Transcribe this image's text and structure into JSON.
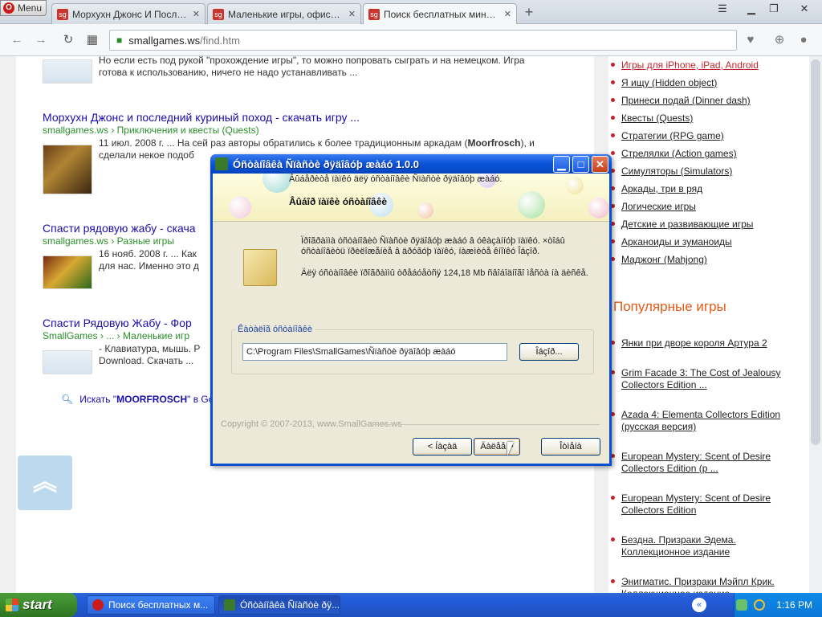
{
  "browser": {
    "menu_label": "Menu",
    "tabs": [
      {
        "label": "Морхухн Джонс И Последний...",
        "active": false
      },
      {
        "label": "Маленькие игры, офисные...",
        "active": false
      },
      {
        "label": "Поиск бесплатных мини игр...",
        "active": true
      }
    ],
    "address": {
      "host": "smallgames.ws",
      "path": "/find.htm"
    }
  },
  "results": [
    {
      "title": "",
      "url": "",
      "desc": "Но если есть под рукой \"прохождение игры\", то можно попровать сыграть и на немецком. Игра готова к использованию, ничего не надо устанавливать ..."
    },
    {
      "title": "Морхухн Джонс и последний куриный поход - скачать игру ...",
      "url": "smallgames.ws › Приключения и квесты (Quests)",
      "desc_date": "11 июл. 2008 г.",
      "desc_pre": " ... На сей раз авторы обратились к более традиционным аркадам (",
      "desc_bold": "Moorfrosch",
      "desc_post": "), и сделали некое подоб"
    },
    {
      "title": "Спасти рядовую жабу - скача",
      "url": "smallgames.ws › Разные игры",
      "desc_date": "16 нояб. 2008 г.",
      "desc_pre": " ... Как",
      "desc_line2": "для нас. Именно это д"
    },
    {
      "title": "Спасти Рядовую Жабу - Фор",
      "url": "SmallGames › ... › Маленькие игр",
      "desc_line1": "- Клавиатура, мышь. Р",
      "desc_line2": "Download. Скачать ..."
    }
  ],
  "search_more": {
    "prefix": "Искать \"",
    "query": "MOORFROSCH",
    "suffix": "\" в Go"
  },
  "sidebar": {
    "categories": [
      {
        "label": "Игры для iPhone, iPad, Android",
        "active": true
      },
      {
        "label": "Я ищу (Hidden object)",
        "active": false
      },
      {
        "label": "Принеси подай (Dinner dash)",
        "active": false
      },
      {
        "label": "Квесты (Quests)",
        "active": false
      },
      {
        "label": "Стратегии (RPG game)",
        "active": false
      },
      {
        "label": "Стрелялки (Action games)",
        "active": false
      },
      {
        "label": "Симуляторы (Simulators)",
        "active": false
      },
      {
        "label": "Аркады, три в ряд",
        "active": false
      },
      {
        "label": "Логические игры",
        "active": false
      },
      {
        "label": "Детские и развивающие игры",
        "active": false
      },
      {
        "label": "Арканоиды и зуманоиды",
        "active": false
      },
      {
        "label": "Маджонг (Mahjong)",
        "active": false
      }
    ],
    "popular_title": "Популярные игры",
    "popular": [
      "Янки при дворе короля Артура 2",
      "Grim Facade 3: The Cost of Jealousy Collectors Edition ...",
      "Azada 4: Elementa Collectors Edition (русская версия)",
      "European Mystery: Scent of Desire Collectors Edition (р ...",
      "European Mystery: Scent of Desire Collectors Edition",
      "Бездна. Призраки Эдема. Коллекционное издание",
      "Энигматис. Призраки Мэйпл Крик. Коллекционное издание"
    ]
  },
  "installer": {
    "title": "Óñòàíîâêà Ñïàñòè ðÿäîâóþ æàáó 1.0.0",
    "banner_title": "Âûáåðèòå ïàïêó äëÿ óñòàíîâêè Ñïàñòè ðÿäîâóþ æàáó.",
    "banner_sub": "Âûáîð ïàïêè óñòàíîâêè",
    "text1": "Ïðîãðàììà óñòàíîâèò Ñïàñòè ðÿäîâóþ æàáó â óêàçàííóþ ïàïêó. ×òîáû óñòàíîâèòü ïðèëîæåíèå â äðóãóþ ïàïêó, íàæìèòå êíîïêó Îáçîð.",
    "text2": "Äëÿ óñòàíîâêè ïðîãðàììû òðåáóåòñÿ 124,18 Mb ñâîáîäíîãî ìåñòà íà äèñêå.",
    "group_label": "Êàòàëîã óñòàíîâêè",
    "path_value": "C:\\Program Files\\SmallGames\\Ñïàñòè ðÿäîâóþ æàáó",
    "browse_label": "Îáçîð...",
    "copyright": "Copyright © 2007-2013, www.SmallGames.ws",
    "back_label": "< Íàçàä",
    "next_label": "Äàëåå >",
    "cancel_label": "Îòìåíà"
  },
  "taskbar": {
    "start_label": "start",
    "items": [
      {
        "label": "Поиск бесплатных м..."
      },
      {
        "label": "Óñòàíîâêà Ñïàñòè ðÿ..."
      }
    ],
    "clock": "1:16 PM"
  }
}
